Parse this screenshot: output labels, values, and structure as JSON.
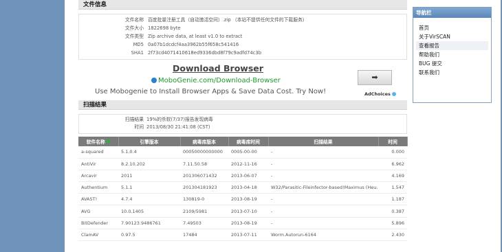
{
  "file_info": {
    "header": "文件信息",
    "rows": [
      {
        "key": "文件名称",
        "value": "百度批量注册工具（自动激活空间）.zip （本站不提供任何文件的下载服务）"
      },
      {
        "key": "文件大小",
        "value": "1822698 byte"
      },
      {
        "key": "文件类型",
        "value": "Zip archive data, at least v1.0 to extract"
      },
      {
        "key": "MD5",
        "value": "0a07b1dcdcf4aa3962b55f658c541416"
      },
      {
        "key": "SHA1",
        "value": "2f73cd4071410618ed9336dbd8f79c9adfd74c3b"
      }
    ]
  },
  "ad": {
    "title": "Download Browser",
    "url": "MoboGenie.com/Download-Browser",
    "text": "Use Mobogenie to Install Browser Apps & Save Data Cost. Try Now!",
    "button_glyph": "➡",
    "adchoices_label": "AdChoices"
  },
  "scan": {
    "header": "扫描结果",
    "result_key": "扫描结果",
    "result_value": "19%的杀软(7/37)报告发现病毒",
    "time_key": "时间",
    "time_value": "2013/08/30 21:41:08 (CST)"
  },
  "table": {
    "headers": [
      "软件名称",
      "引擎版本",
      "病毒库版本",
      "病毒库时间",
      "扫描结果",
      "时间"
    ],
    "rows": [
      {
        "name": "a-squared",
        "engine": "5.1.0.4",
        "db": "00050000000000",
        "date": "0005-00-00",
        "result": "-",
        "status": "ok",
        "time": "0.000"
      },
      {
        "name": "AntiVir",
        "engine": "8.2.10.202",
        "db": "7.11.50.58",
        "date": "2012-11-16",
        "result": "-",
        "status": "ok",
        "time": "6.962"
      },
      {
        "name": "Arcavir",
        "engine": "2011",
        "db": "201306071432",
        "date": "2013-06-07",
        "result": "-",
        "status": "ok",
        "time": "4.169"
      },
      {
        "name": "Authentium",
        "engine": "5.1.1",
        "db": "201304181923",
        "date": "2013-04-18",
        "result": "W32/Parasitic-Fileinfector-based!Maximus (Heu...",
        "status": "bad",
        "time": "1.547"
      },
      {
        "name": "AVAST!",
        "engine": "4.7.4",
        "db": "130819-0",
        "date": "2013-08-19",
        "result": "-",
        "status": "ok",
        "time": "1.187"
      },
      {
        "name": "AVG",
        "engine": "10.0.1405",
        "db": "2109/5981",
        "date": "2013-07-10",
        "result": "-",
        "status": "ok",
        "time": "0.387"
      },
      {
        "name": "BitDefender",
        "engine": "7.90123.9486761",
        "db": "7.49503",
        "date": "2013-08-19",
        "result": "-",
        "status": "ok",
        "time": "5.896"
      },
      {
        "name": "ClamAV",
        "engine": "0.97.5",
        "db": "17484",
        "date": "2013-07-11",
        "result": "Worm.Autorun-6164",
        "status": "bad",
        "time": "2.430"
      }
    ]
  },
  "nav": {
    "header": "导航栏",
    "items": [
      "首页",
      "关于VirSCAN",
      "查看报告",
      "帮助我们",
      "BUG 提交",
      "联系我们"
    ],
    "active_index": 2
  },
  "colors": {
    "background": "#6f93bb",
    "nav_header": "#5c87b8",
    "clean": "#2a8a2a",
    "infected": "#d02020",
    "table_header": "#7a7a7a"
  }
}
